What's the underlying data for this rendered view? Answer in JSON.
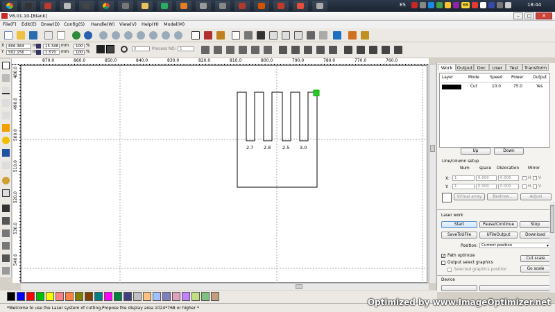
{
  "taskbar": {
    "language": "ES",
    "clock": "18:44",
    "tray_badge": "68"
  },
  "window": {
    "title": "V8.01.10-[Blank]"
  },
  "menu": [
    "File(F)",
    "Edit(E)",
    "Draw(D)",
    "Config(S)",
    "Handle(W)",
    "View(V)",
    "Help(H)",
    "Model(M)"
  ],
  "toolbar2": {
    "pos_x": "806.384",
    "pos_y": "502.156",
    "unit_x": "mm",
    "unit_y": "mm",
    "size_w": "15.346",
    "size_h": "1.570",
    "size_unit_w": "mm",
    "size_unit_h": "mm",
    "scale_w": "100",
    "scale_h": "100",
    "pct_w": "%",
    "pct_h": "%",
    "angle": "0",
    "process_no_label": "Process NO:",
    "process_no": "1"
  },
  "ruler_top": [
    "870.0",
    "860.0",
    "850.0",
    "840.0",
    "830.0",
    "820.0",
    "810.0",
    "800.0",
    "790.0",
    "780.0",
    "770.0",
    "760.0"
  ],
  "ruler_left": [
    "480.0",
    "490.0",
    "500.0",
    "510.0",
    "520.0",
    "530.0",
    "540.0"
  ],
  "drawing": {
    "labels": [
      "2.7",
      "2.8",
      "2.5",
      "3.0"
    ]
  },
  "panel": {
    "tabs": [
      "Work",
      "Output",
      "Doc",
      "User",
      "Test",
      "Transform"
    ],
    "layer_headers": [
      "Layer",
      "Mode",
      "Speed",
      "Power",
      "Output"
    ],
    "layer_row": {
      "mode": "Cut",
      "speed": "10.0",
      "power": "75.0",
      "output": "Yes"
    },
    "up": "Up",
    "down": "Down",
    "rowcol_title": "Line/column setup",
    "rc_headers": [
      "Num",
      "space",
      "Dislocation",
      "Mirror"
    ],
    "x_label": "X:",
    "y_label": "Y:",
    "x_num": "1",
    "y_num": "1",
    "x_space": "0.000",
    "y_space": "0.000",
    "x_disl": "0.000",
    "y_disl": "0.000",
    "mirror_h": "H",
    "mirror_v": "V",
    "virtual_array": "Virtual array",
    "bestrew": "Bestrew...",
    "adjust": "Adjust",
    "laser_work_title": "Laser work",
    "start": "Start",
    "pause": "Pause/Continue",
    "stop": "Stop",
    "save_udfile": "SaveToUFile",
    "udfile_output": "UFileOutput",
    "download": "Download",
    "position_label": "Position:",
    "position_value": "Current position",
    "path_optimize": "Path optimize",
    "output_select": "Output select graphics",
    "selected_graphics": "Selected graphics position",
    "cut_scale": "Cut scale",
    "go_scale": "Go scale",
    "device_title": "Device"
  },
  "palette": [
    "#000000",
    "#0000ff",
    "#ff0000",
    "#00c000",
    "#ffff00",
    "#ff8080",
    "#ff8040",
    "#808000",
    "#804000",
    "#008080",
    "#ff00ff",
    "#008040",
    "#404080",
    "#c0c0c0",
    "#ffc080",
    "#a0c0ff",
    "#8080c0",
    "#e0a0c0",
    "#c080ff",
    "#c0e080",
    "#80c080",
    "#c0a080"
  ],
  "status": {
    "message": "*Welcome to use the Laser system of cutting,Propose the display area 1024*768 or higher *"
  },
  "watermark": "Optimized by www.ImageOptimizer.net"
}
